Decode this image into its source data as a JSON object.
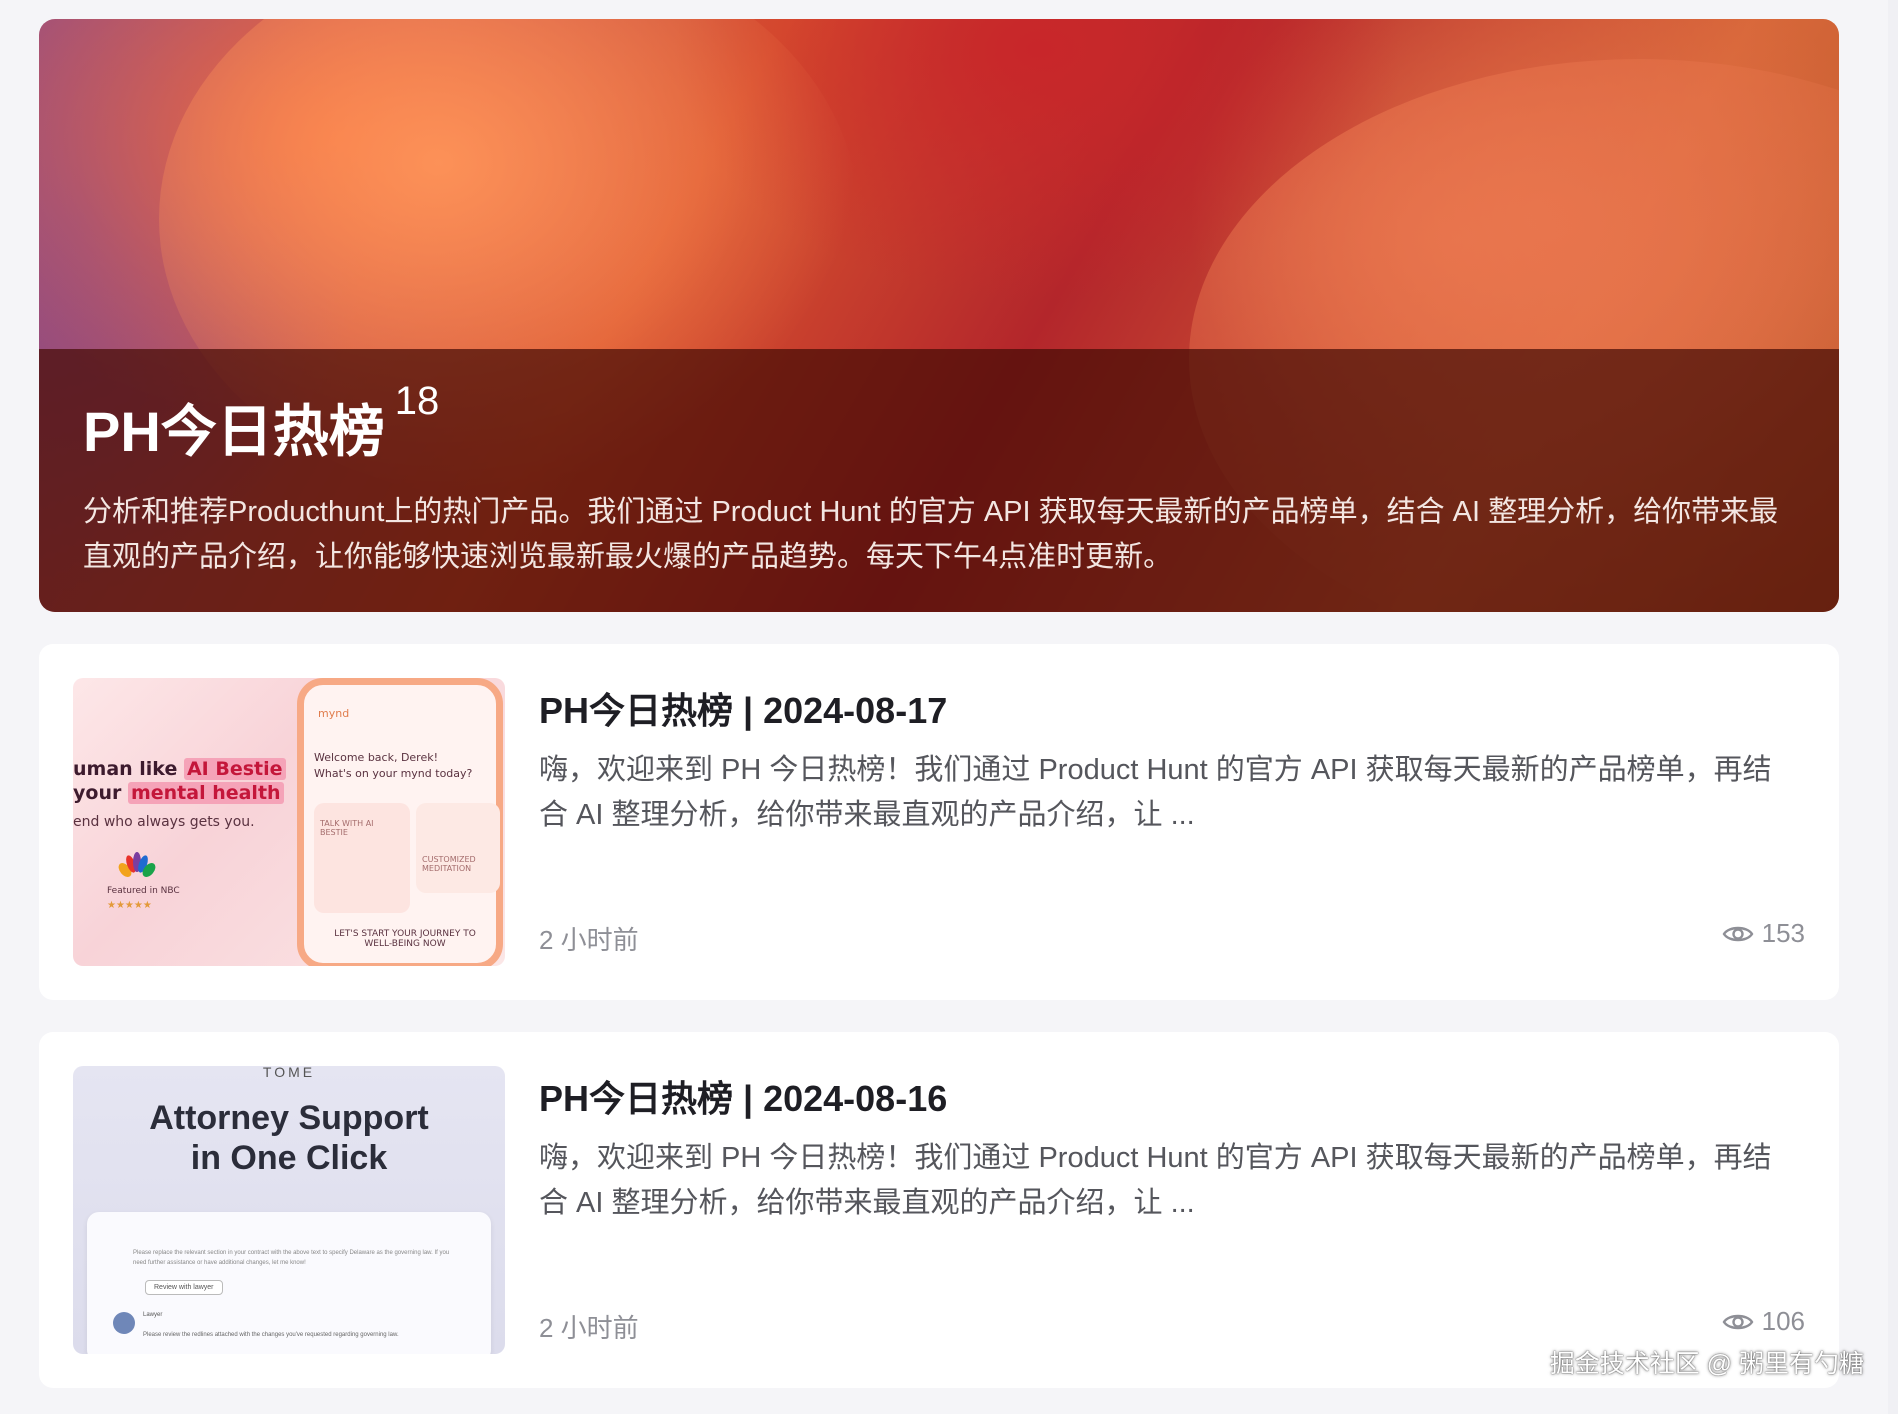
{
  "hero": {
    "title": "PH今日热榜",
    "count": "18",
    "description": "分析和推荐Producthunt上的热门产品。我们通过 Product Hunt 的官方 API 获取每天最新的产品榜单，结合 AI 整理分析，给你带来最直观的产品介绍，让你能够快速浏览最新最火爆的产品趋势。每天下午4点准时更新。"
  },
  "articles": [
    {
      "title": "PH今日热榜 | 2024-08-17",
      "summary": "嗨，欢迎来到 PH 今日热榜！我们通过 Product Hunt 的官方 API 获取每天最新的产品榜单，再结合 AI 整理分析，给你带来最直观的产品介绍，让 ...",
      "time": "2 小时前",
      "views": "153",
      "thumbnail": {
        "brand": "mynd",
        "headline_1a": "uman like ",
        "headline_1b": "AI Bestie",
        "headline_2a": " your ",
        "headline_2b": "mental health",
        "tagline": "end who always gets you.",
        "badge": "Featured in NBC",
        "stars": "★★★★★",
        "welcome": "Welcome back, Derek!",
        "prompt": "What's on your mynd today?",
        "tile_1": "TALK WITH AI BESTIE",
        "tile_2": "CUSTOMIZED MEDITATION",
        "journey": "LET'S START YOUR JOURNEY TO WELL-BEING NOW"
      }
    },
    {
      "title": "PH今日热榜 | 2024-08-16",
      "summary": "嗨，欢迎来到 PH 今日热榜！我们通过 Product Hunt 的官方 API 获取每天最新的产品榜单，再结合 AI 整理分析，给你带来最直观的产品介绍，让 ...",
      "time": "2 小时前",
      "views": "106",
      "thumbnail": {
        "brand": "TOME",
        "headline_1": "Attorney Support",
        "headline_2": "in One Click",
        "line_1": "Please replace the relevant section in your contract with the above text to specify Delaware as the governing law. If you need further assistance or have additional changes, let me know!",
        "button": "Review with lawyer",
        "lawyer": "Lawyer",
        "line_2": "Please review the redlines attached with the changes you've requested regarding governing law."
      }
    }
  ],
  "watermark": "掘金技术社区 @ 粥里有勺糖"
}
